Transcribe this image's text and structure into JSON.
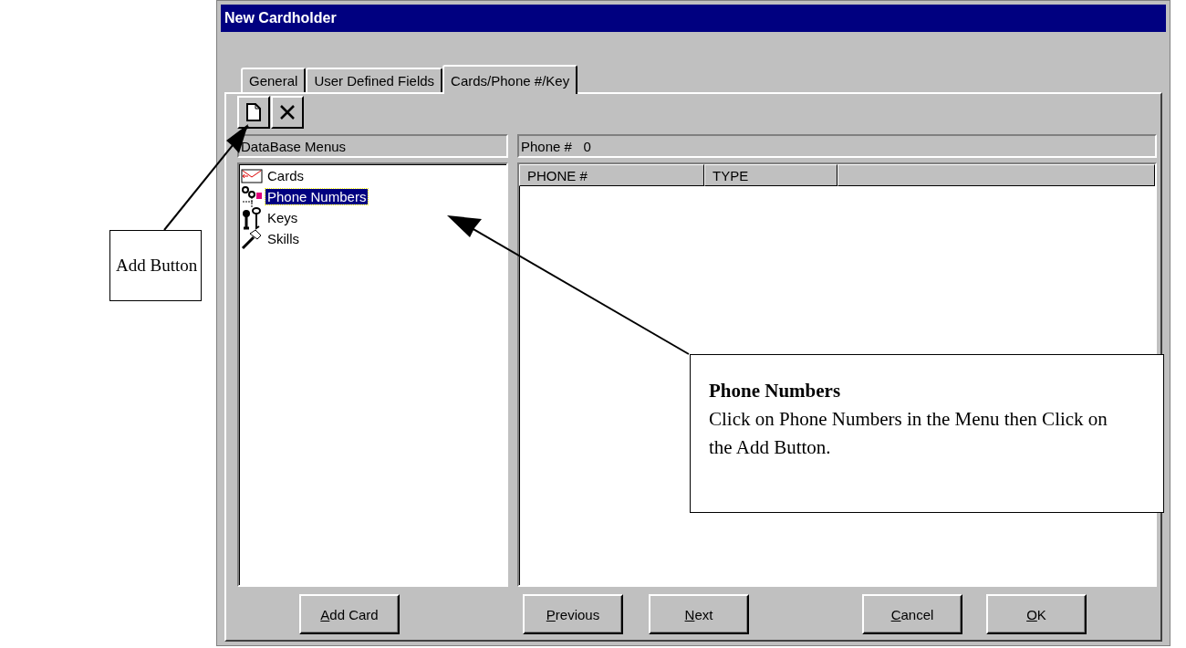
{
  "window": {
    "title": "New Cardholder"
  },
  "tabs": [
    {
      "label": "General",
      "selected": false
    },
    {
      "label": "User Defined Fields",
      "selected": false
    },
    {
      "label": "Cards/Phone #/Key",
      "selected": true
    }
  ],
  "menu_panel": {
    "header": "DataBase Menus",
    "items": [
      {
        "label": "Cards",
        "selected": false
      },
      {
        "label": "Phone Numbers",
        "selected": true
      },
      {
        "label": "Keys",
        "selected": false
      },
      {
        "label": "Skills",
        "selected": false
      }
    ]
  },
  "detail_panel": {
    "header": "Phone #   0",
    "columns": [
      "PHONE #",
      "TYPE"
    ]
  },
  "buttons": [
    {
      "accel": "A",
      "rest": "dd Card"
    },
    {
      "accel": "P",
      "rest": "revious"
    },
    {
      "accel": "N",
      "rest": "ext"
    },
    {
      "accel": "C",
      "rest": "ancel"
    },
    {
      "accel": "O",
      "rest": "K"
    }
  ],
  "callouts": [
    {
      "kind": "plain",
      "text": "Add Button"
    },
    {
      "kind": "titled",
      "title": "Phone Numbers",
      "text": "Click on Phone Numbers in the Menu then Click on the Add Button."
    }
  ]
}
